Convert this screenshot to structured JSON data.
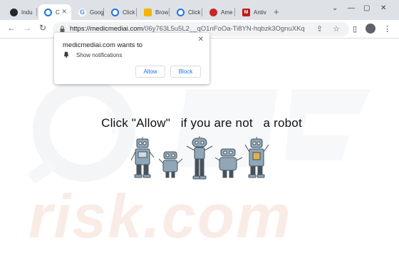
{
  "tabs": [
    {
      "label": "Indu",
      "icon": "github-icon",
      "color": "#24292e",
      "active": false
    },
    {
      "label": "C",
      "icon": "loading-icon",
      "color": "#1a73e8",
      "active": true
    },
    {
      "label": "Goog",
      "icon": "google-icon",
      "color": "#4285f4",
      "active": false
    },
    {
      "label": "Click",
      "icon": "loading-icon",
      "color": "#1a73e8",
      "active": false
    },
    {
      "label": "Brow",
      "icon": "folder-icon",
      "color": "#f4b400",
      "active": false
    },
    {
      "label": "Click",
      "icon": "loading-icon",
      "color": "#1a73e8",
      "active": false
    },
    {
      "label": "Ame",
      "icon": "shield-icon",
      "color": "#c62828",
      "active": false
    },
    {
      "label": "Antiv",
      "icon": "mcafee-icon",
      "color": "#c01818",
      "active": false
    }
  ],
  "tab_close_glyph": "✕",
  "new_tab_glyph": "+",
  "window_controls": {
    "chevron": "⌄",
    "minimize": "—",
    "maximize": "▢",
    "close": "✕"
  },
  "toolbar": {
    "back": "←",
    "forward": "→",
    "reload": "↻",
    "share": "⇪",
    "star": "☆",
    "sidebar": "▯",
    "menu": "⋮"
  },
  "address": {
    "host": "https://medicmediai.com",
    "path": "/06y763L5u5L2__qO1nFoOa-Ti8YN-hqbzk3OgnuXKqk..."
  },
  "permission_prompt": {
    "title": "medicmediai.com wants to",
    "close": "✕",
    "item": "Show notifications",
    "allow": "Allow",
    "block": "Block"
  },
  "page": {
    "headline": "Click \"Allow\"   if you are not   a robot"
  },
  "watermark": {
    "text": "risk.com",
    "color": "#f6e6df"
  },
  "colors": {
    "accent": "#1a73e8",
    "tabstrip": "#dee1e6",
    "robot_body": "#8fa7b7",
    "robot_dark": "#46525c"
  }
}
